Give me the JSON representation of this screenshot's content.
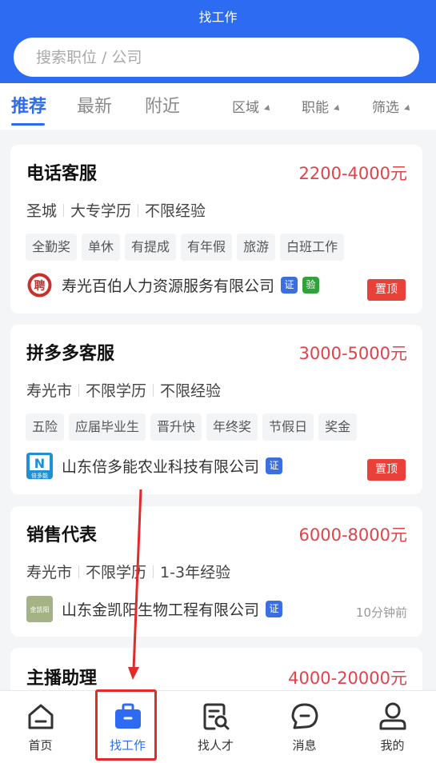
{
  "header": {
    "title": "找工作"
  },
  "search": {
    "placeholder": "搜索职位 / 公司"
  },
  "tabs": [
    {
      "label": "推荐",
      "active": true
    },
    {
      "label": "最新",
      "active": false
    },
    {
      "label": "附近",
      "active": false
    }
  ],
  "filters": [
    "区域",
    "职能",
    "筛选"
  ],
  "jobs": [
    {
      "title": "电话客服",
      "salary": "2200-4000元",
      "location": "圣城",
      "education": "大专学历",
      "experience": "不限经验",
      "tags": [
        "全勤奖",
        "单休",
        "有提成",
        "有年假",
        "旅游",
        "白班工作"
      ],
      "company": "寿光百伯人力资源服务有限公司",
      "logo_text": "聘",
      "badges": [
        "证",
        "验"
      ],
      "pin": "置顶"
    },
    {
      "title": "拼多多客服",
      "salary": "3000-5000元",
      "location": "寿光市",
      "education": "不限学历",
      "experience": "不限经验",
      "tags": [
        "五险",
        "应届毕业生",
        "晋升快",
        "年终奖",
        "节假日",
        "奖金"
      ],
      "company": "山东倍多能农业科技有限公司",
      "logo_text": "倍多能",
      "logo_letter": "N",
      "badges": [
        "证"
      ],
      "pin": "置顶"
    },
    {
      "title": "销售代表",
      "salary": "6000-8000元",
      "location": "寿光市",
      "education": "不限学历",
      "experience": "1-3年经验",
      "company": "山东金凯阳生物工程有限公司",
      "logo_text": "金凯阳",
      "badges": [
        "证"
      ],
      "time": "10分钟前"
    },
    {
      "title": "主播助理",
      "salary": "4000-20000元"
    }
  ],
  "nav": [
    {
      "label": "首页",
      "icon": "home-icon"
    },
    {
      "label": "找工作",
      "icon": "briefcase-icon",
      "active": true
    },
    {
      "label": "找人才",
      "icon": "resume-search-icon"
    },
    {
      "label": "消息",
      "icon": "message-icon"
    },
    {
      "label": "我的",
      "icon": "profile-icon"
    }
  ],
  "colors": {
    "primary": "#2d6cf2",
    "salary": "#e0434a",
    "pin": "#e8413a",
    "cert_badge": "#3b6fe0",
    "verify_badge": "#2fa33a",
    "annotation": "#e22a2a"
  }
}
